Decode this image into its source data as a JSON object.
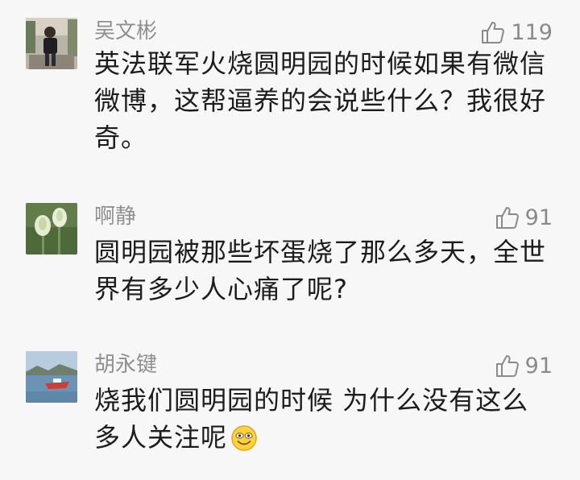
{
  "comments": [
    {
      "author": "吴文彬",
      "likes": "119",
      "text": "英法联军火烧圆明园的时候如果有微信微博，这帮逼养的会说些什么？我很好奇。",
      "avatar_icon": "person-photo-avatar"
    },
    {
      "author": "啊静",
      "likes": "91",
      "text": "圆明园被那些坏蛋烧了那么多天，全世界有多少人心痛了呢?",
      "avatar_icon": "lotus-bud-avatar"
    },
    {
      "author": "胡永键",
      "likes": "91",
      "text": "烧我们圆明园的时候 为什么没有这么多人关注呢",
      "emoji": "smiley-face-emoji",
      "avatar_icon": "lake-boat-avatar"
    }
  ],
  "icons": {
    "like": "thumbs-up-icon"
  },
  "colors": {
    "background": "#f7f7f7",
    "name": "#8f8f8f",
    "text": "#1c1c1c",
    "like": "#8a8a8a"
  }
}
